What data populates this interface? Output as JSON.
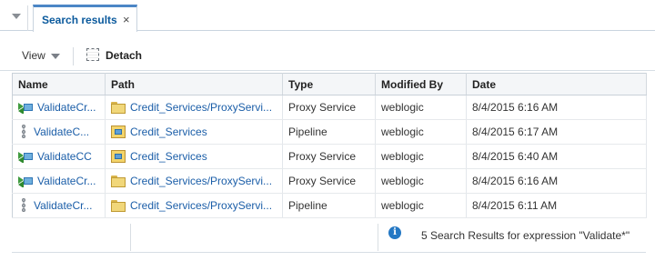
{
  "tab": {
    "label": "Search results",
    "close_glyph": "×"
  },
  "toolbar": {
    "view_label": "View",
    "detach_label": "Detach"
  },
  "table": {
    "columns": [
      "Name",
      "Path",
      "Type",
      "Modified By",
      "Date"
    ],
    "rows": [
      {
        "name": "ValidateCr...",
        "name_icon": "proxy-service-icon",
        "path": "Credit_Services/ProxyServi...",
        "path_icon": "folder-icon",
        "type": "Proxy Service",
        "modified_by": "weblogic",
        "date": "8/4/2015 6:16 AM"
      },
      {
        "name": "ValidateC...",
        "name_icon": "pipeline-icon",
        "path": "Credit_Services",
        "path_icon": "project-icon",
        "type": "Pipeline",
        "modified_by": "weblogic",
        "date": "8/4/2015 6:17 AM"
      },
      {
        "name": "ValidateCC",
        "name_icon": "proxy-service-icon",
        "path": "Credit_Services",
        "path_icon": "project-icon",
        "type": "Proxy Service",
        "modified_by": "weblogic",
        "date": "8/4/2015 6:40 AM"
      },
      {
        "name": "ValidateCr...",
        "name_icon": "proxy-service-icon",
        "path": "Credit_Services/ProxyServi...",
        "path_icon": "folder-icon",
        "type": "Proxy Service",
        "modified_by": "weblogic",
        "date": "8/4/2015 6:16 AM"
      },
      {
        "name": "ValidateCr...",
        "name_icon": "pipeline-icon",
        "path": "Credit_Services/ProxyServi...",
        "path_icon": "folder-icon",
        "type": "Pipeline",
        "modified_by": "weblogic",
        "date": "8/4/2015 6:11 AM"
      }
    ]
  },
  "status": {
    "info_glyph": "i",
    "text": "5 Search Results for expression \"Validate*\""
  }
}
